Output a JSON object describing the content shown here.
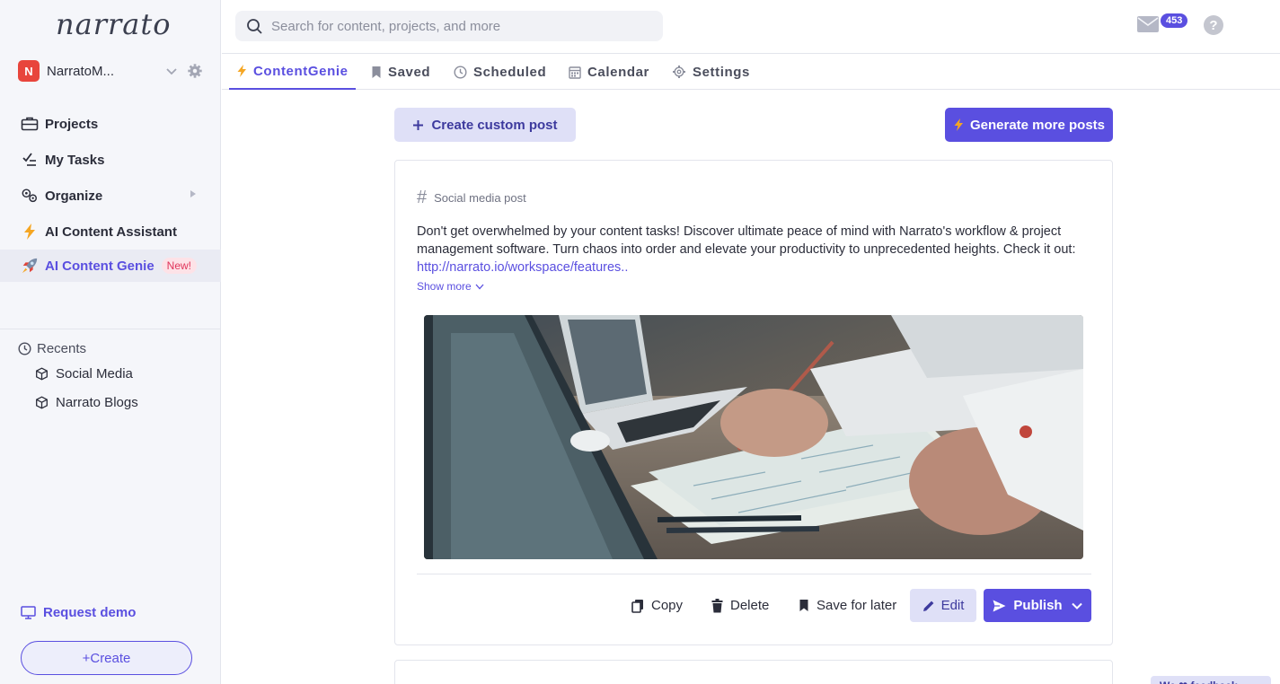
{
  "app": {
    "logo": "narrato"
  },
  "workspace": {
    "initial": "N",
    "name": "NarratoM..."
  },
  "sidebar": {
    "items": [
      {
        "label": "Projects",
        "icon": "briefcase-icon"
      },
      {
        "label": "My Tasks",
        "icon": "check-list-icon"
      },
      {
        "label": "Organize",
        "icon": "gears-icon"
      },
      {
        "label": "AI Content Assistant",
        "icon": "lightning-icon"
      },
      {
        "label": "AI Content Genie",
        "icon": "rocket-icon",
        "badge": "New!"
      }
    ],
    "recents_title": "Recents",
    "recents": [
      {
        "label": "Social Media",
        "icon": "cube-icon"
      },
      {
        "label": "Narrato Blogs",
        "icon": "cube-icon"
      }
    ],
    "request_demo": "Request demo",
    "create_label": "Create",
    "create_prefix": "+"
  },
  "search": {
    "placeholder": "Search for content, projects, and more",
    "value": ""
  },
  "header": {
    "mail_count": "453",
    "help_label": "?"
  },
  "tabs": [
    {
      "label": "ContentGenie",
      "active": true
    },
    {
      "label": "Saved",
      "active": false
    },
    {
      "label": "Scheduled",
      "active": false
    },
    {
      "label": "Calendar",
      "active": false
    },
    {
      "label": "Settings",
      "active": false
    }
  ],
  "main": {
    "create_custom_post": "Create custom post",
    "generate_more_posts": "Generate more posts",
    "post": {
      "type": "Social media post",
      "body": "Don't get overwhelmed by your content tasks! Discover ultimate peace of mind with Narrato's workflow & project management software. Turn chaos into order and elevate your productivity to unprecedented heights. Check it out: ",
      "link": "http://narrato.io/workspace/features..",
      "show_more": "Show more",
      "actions": {
        "copy": "Copy",
        "delete": "Delete",
        "save_for_later": "Save for later",
        "edit": "Edit",
        "publish": "Publish"
      }
    }
  },
  "feedback": {
    "label": "We ❤ feedback"
  },
  "colors": {
    "accent": "#5a4fe0",
    "accent_light": "#dfe0f7",
    "sidebar_bg": "#f5f6fa",
    "workspace_avatar": "#e8453c"
  }
}
